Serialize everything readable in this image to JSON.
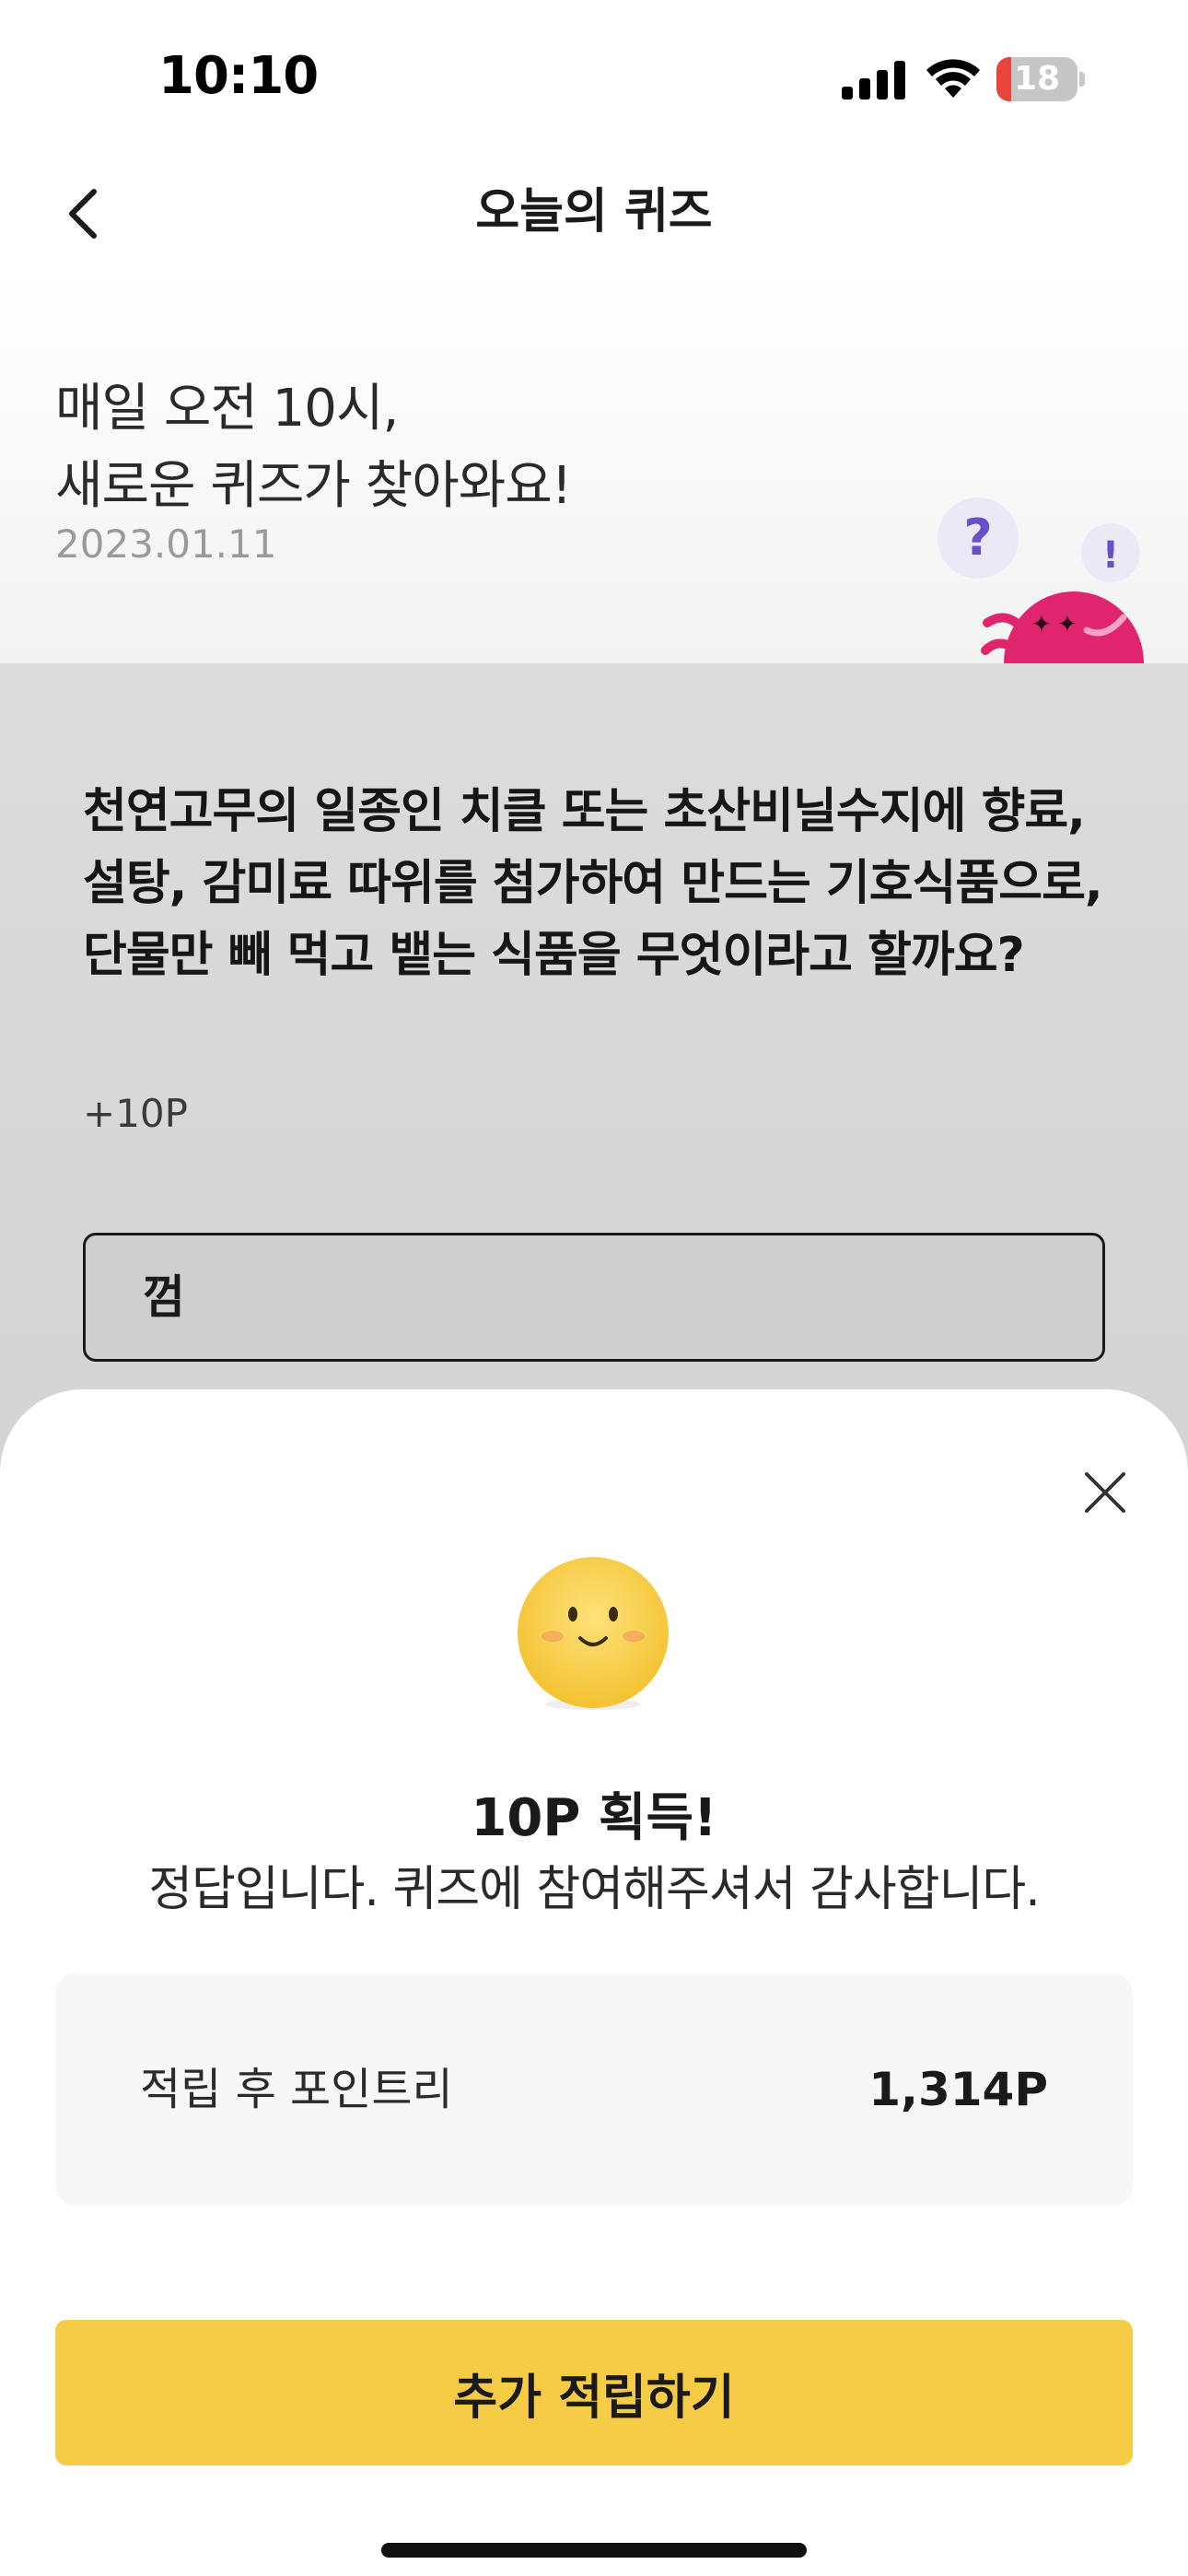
{
  "status_bar": {
    "time": "10:10",
    "battery_level": "18",
    "battery_fraction": 0.18,
    "signal_icon": "cellular-signal-icon",
    "wifi_icon": "wifi-icon"
  },
  "nav": {
    "title": "오늘의 퀴즈",
    "back_icon": "chevron-left-icon"
  },
  "header": {
    "line1": "매일 오전 10시,",
    "line2": "새로운 퀴즈가 찾아와요!",
    "date": "2023.01.11",
    "mascot_icon": "quiz-mascot-icon"
  },
  "quiz": {
    "question": "천연고무의 일종인 치클 또는 초산비닐수지에 향료, 설탕, 감미료 따위를 첨가하여 만드는 기호식품으로, 단물만 빼 먹고 뱉는 식품을 무엇이라고 할까요?",
    "reward": "+10P",
    "answer": "껌"
  },
  "result_sheet": {
    "close_icon": "close-icon",
    "emoji_icon": "smiley-face-icon",
    "title": "10P 획득!",
    "message": "정답입니다. 퀴즈에 참여해주셔서 감사합니다.",
    "balance_label": "적립 후 포인트리",
    "balance_value": "1,314P",
    "button_label": "추가 적립하기"
  },
  "colors": {
    "accent": "#F6CB45",
    "mascot": "#E0246E",
    "battery_low": "#E9443B"
  }
}
